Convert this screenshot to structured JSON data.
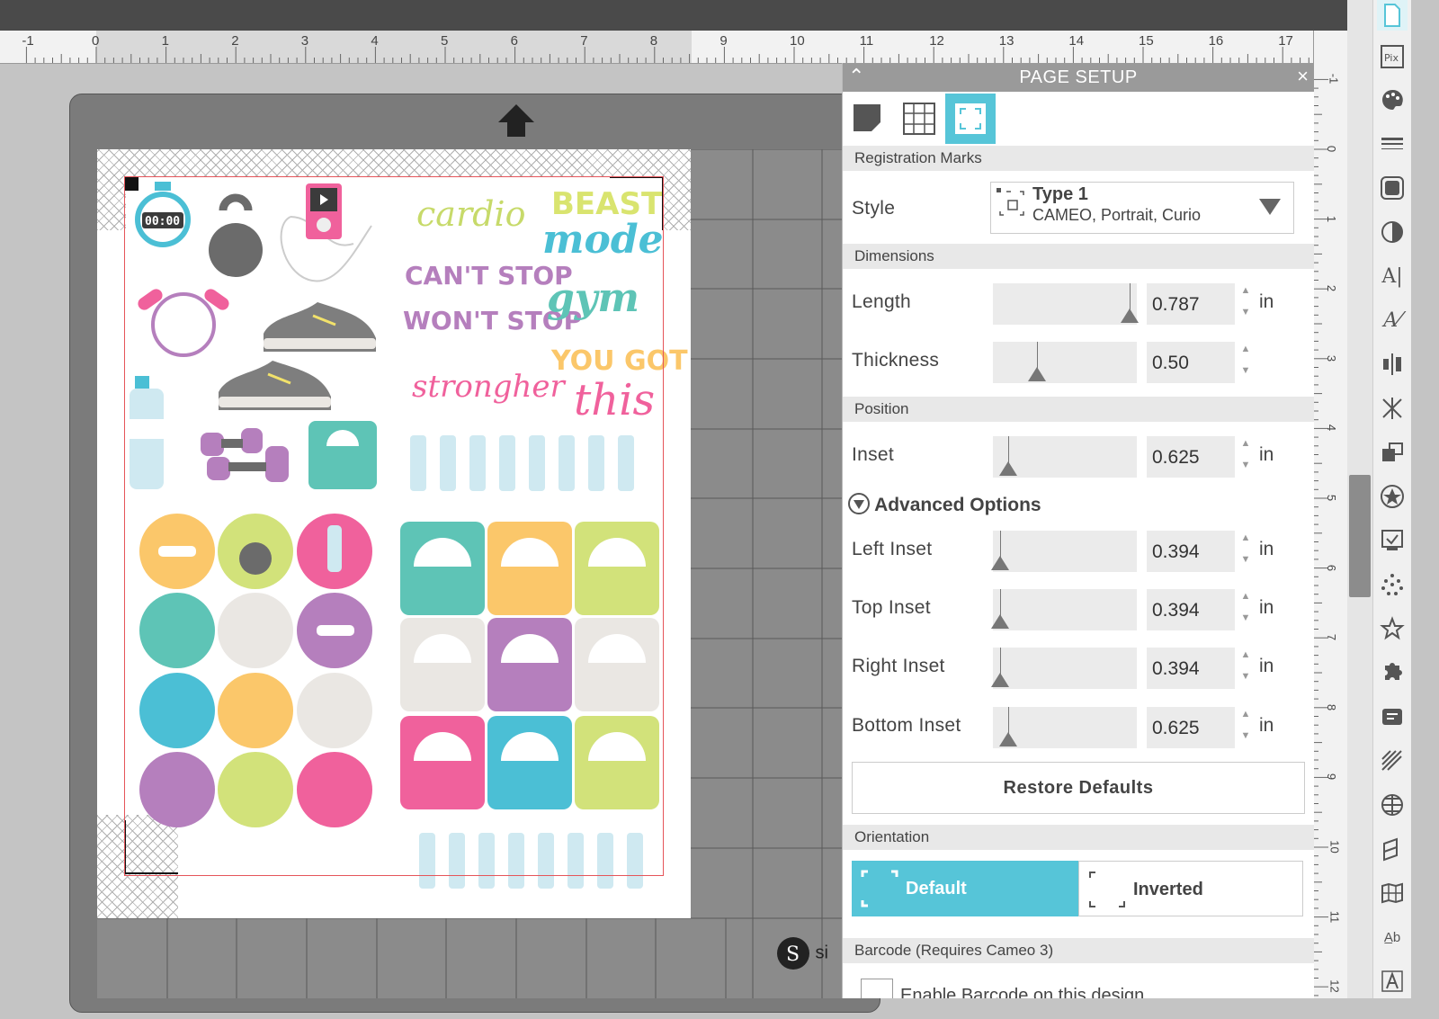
{
  "ruler": {
    "horizontal_labels": [
      "-1",
      "0",
      "1",
      "2",
      "3",
      "4",
      "5",
      "6",
      "7",
      "8",
      "9",
      "10",
      "11",
      "12",
      "13",
      "14",
      "15",
      "16",
      "17"
    ],
    "vertical_labels": [
      "-1",
      "0",
      "1",
      "2",
      "3",
      "4",
      "5",
      "6",
      "7",
      "8",
      "9",
      "10",
      "11",
      "12"
    ]
  },
  "panel": {
    "title": "PAGE SETUP",
    "tabs": [
      "media-icon",
      "grid-icon",
      "registration-icon"
    ],
    "registration_section": "Registration Marks",
    "style_label": "Style",
    "style_value_title": "Type 1",
    "style_value_subtitle": "CAMEO, Portrait, Curio",
    "dimensions_section": "Dimensions",
    "length_label": "Length",
    "length_value": "0.787",
    "length_slider": 0.95,
    "thickness_label": "Thickness",
    "thickness_value": "0.50",
    "thickness_slider": 0.3,
    "unit": "in",
    "position_section": "Position",
    "inset_label": "Inset",
    "inset_value": "0.625",
    "inset_slider": 0.1,
    "advanced_label": "Advanced Options",
    "left_inset_label": "Left Inset",
    "left_inset_value": "0.394",
    "top_inset_label": "Top Inset",
    "top_inset_value": "0.394",
    "right_inset_label": "Right Inset",
    "right_inset_value": "0.394",
    "bottom_inset_label": "Bottom Inset",
    "bottom_inset_value": "0.625",
    "restore_label": "Restore Defaults",
    "orientation_section": "Orientation",
    "orientation_default": "Default",
    "orientation_inverted": "Inverted",
    "barcode_section": "Barcode (Requires Cameo 3)",
    "barcode_checkbox_label": "Enable Barcode on this design"
  },
  "canvas": {
    "sticker_words": [
      "cardio",
      "BEAST",
      "mode",
      "CAN'T STOP",
      "WON'T STOP",
      "gym",
      "strongher",
      "YOU GOT",
      "this"
    ],
    "timer_text": "00:00",
    "brand_text": "si"
  },
  "colors": {
    "accent": "#56c5d8",
    "teal": "#5ec4b6",
    "orange": "#fbc76a",
    "lime": "#d2e27a",
    "pink": "#f0619c",
    "purple": "#b57fbd",
    "beige": "#eae7e3",
    "blue": "#4bbfd5",
    "gray": "#6b6b6b"
  }
}
